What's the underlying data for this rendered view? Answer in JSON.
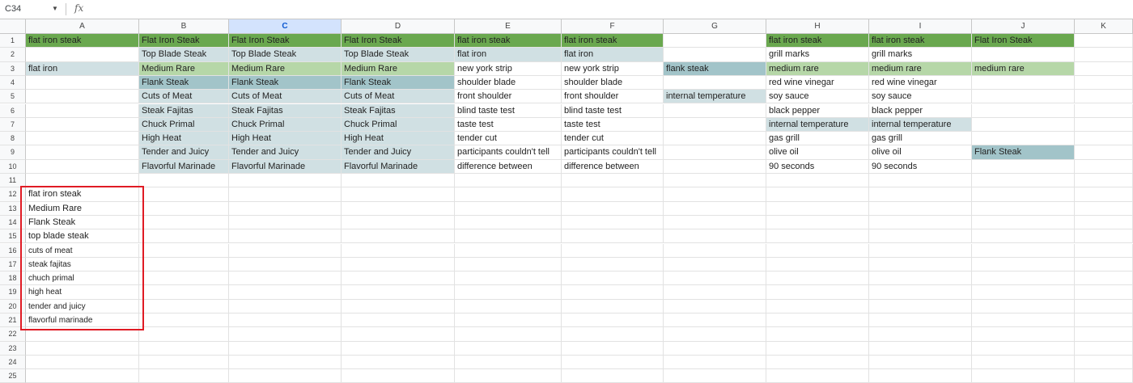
{
  "formula_bar": {
    "name_box": "C34",
    "fx_label": "fx"
  },
  "columns": [
    "A",
    "B",
    "C",
    "D",
    "E",
    "F",
    "G",
    "H",
    "I",
    "J",
    "K"
  ],
  "selected_column": "C",
  "rows": [
    "1",
    "2",
    "3",
    "4",
    "5",
    "6",
    "7",
    "8",
    "9",
    "10",
    "11",
    "12",
    "13",
    "14",
    "15",
    "16",
    "17",
    "18",
    "19",
    "20",
    "21",
    "22",
    "23",
    "24",
    "25"
  ],
  "cells": {
    "A1": "flat iron steak",
    "B1": "Flat Iron Steak",
    "C1": "Flat Iron Steak",
    "D1": "Flat Iron Steak",
    "E1": "flat iron steak",
    "F1": "flat iron steak",
    "H1": "flat iron steak",
    "I1": "flat iron steak",
    "J1": "Flat Iron Steak",
    "B2": "Top Blade Steak",
    "C2": "Top Blade Steak",
    "D2": "Top Blade Steak",
    "E2": "flat iron",
    "F2": "flat iron",
    "H2": "grill marks",
    "I2": "grill marks",
    "A3": "flat iron",
    "B3": "Medium Rare",
    "C3": "Medium Rare",
    "D3": "Medium Rare",
    "E3": "new york strip",
    "F3": "new york strip",
    "G3": "flank steak",
    "H3": "medium rare",
    "I3": "medium rare",
    "J3": "medium rare",
    "B4": "Flank Steak",
    "C4": "Flank Steak",
    "D4": "Flank Steak",
    "E4": "shoulder blade",
    "F4": "shoulder blade",
    "H4": "red wine vinegar",
    "I4": "red wine vinegar",
    "B5": "Cuts of Meat",
    "C5": "Cuts of Meat",
    "D5": "Cuts of Meat",
    "E5": "front shoulder",
    "F5": "front shoulder",
    "G5": "internal temperature",
    "H5": "soy sauce",
    "I5": "soy sauce",
    "B6": "Steak Fajitas",
    "C6": "Steak Fajitas",
    "D6": "Steak Fajitas",
    "E6": "blind taste test",
    "F6": "blind taste test",
    "H6": "black pepper",
    "I6": "black pepper",
    "B7": "Chuck Primal",
    "C7": "Chuck Primal",
    "D7": "Chuck Primal",
    "E7": "taste test",
    "F7": "taste test",
    "H7": "internal temperature",
    "I7": "internal temperature",
    "B8": "High Heat",
    "C8": "High Heat",
    "D8": "High Heat",
    "E8": "tender cut",
    "F8": "tender cut",
    "H8": "gas grill",
    "I8": "gas grill",
    "B9": "Tender and Juicy",
    "C9": "Tender and Juicy",
    "D9": "Tender and Juicy",
    "E9": "participants couldn't tell",
    "F9": "participants couldn't tell",
    "H9": "olive oil",
    "I9": "olive oil",
    "J9": "Flank Steak",
    "B10": "Flavorful Marinade",
    "C10": "Flavorful Marinade",
    "D10": "Flavorful Marinade",
    "E10": "difference between",
    "F10": "difference between",
    "H10": "90 seconds",
    "I10": "90 seconds",
    "A12": "flat iron steak",
    "A13": "Medium Rare",
    "A14": "Flank Steak",
    "A15": "top blade steak",
    "A16": "cuts of meat",
    "A17": "steak fajitas",
    "A18": "chuch primal",
    "A19": "high heat",
    "A20": "tender and juicy",
    "A21": "flavorful marinade"
  },
  "cell_fills": {
    "A1": "g1",
    "B1": "g1",
    "C1": "g1",
    "D1": "g1",
    "E1": "g1",
    "F1": "g1",
    "H1": "g1",
    "I1": "g1",
    "J1": "g1",
    "B2": "b1",
    "C2": "b1",
    "D2": "b1",
    "E2": "b1",
    "F2": "b1",
    "A3": "b1",
    "B3": "g2",
    "C3": "g2",
    "D3": "g2",
    "G3": "b2",
    "H3": "g2",
    "I3": "g2",
    "J3": "g2",
    "B4": "b2",
    "C4": "b2",
    "D4": "b2",
    "B5": "b1",
    "C5": "b1",
    "D5": "b1",
    "G5": "b1",
    "B6": "b1",
    "C6": "b1",
    "D6": "b1",
    "B7": "b1",
    "C7": "b1",
    "D7": "b1",
    "H7": "b1",
    "I7": "b1",
    "B8": "b1",
    "C8": "b1",
    "D8": "b1",
    "B9": "b1",
    "C9": "b1",
    "D9": "b1",
    "J9": "b2",
    "B10": "b1",
    "C10": "b1",
    "D10": "b1"
  },
  "colors": {
    "header_green": "#6aa84f",
    "light_green": "#b6d7a8",
    "light_blue": "#d0e0e3",
    "mid_blue": "#a2c4c9",
    "highlight_box": "#e01b24"
  }
}
